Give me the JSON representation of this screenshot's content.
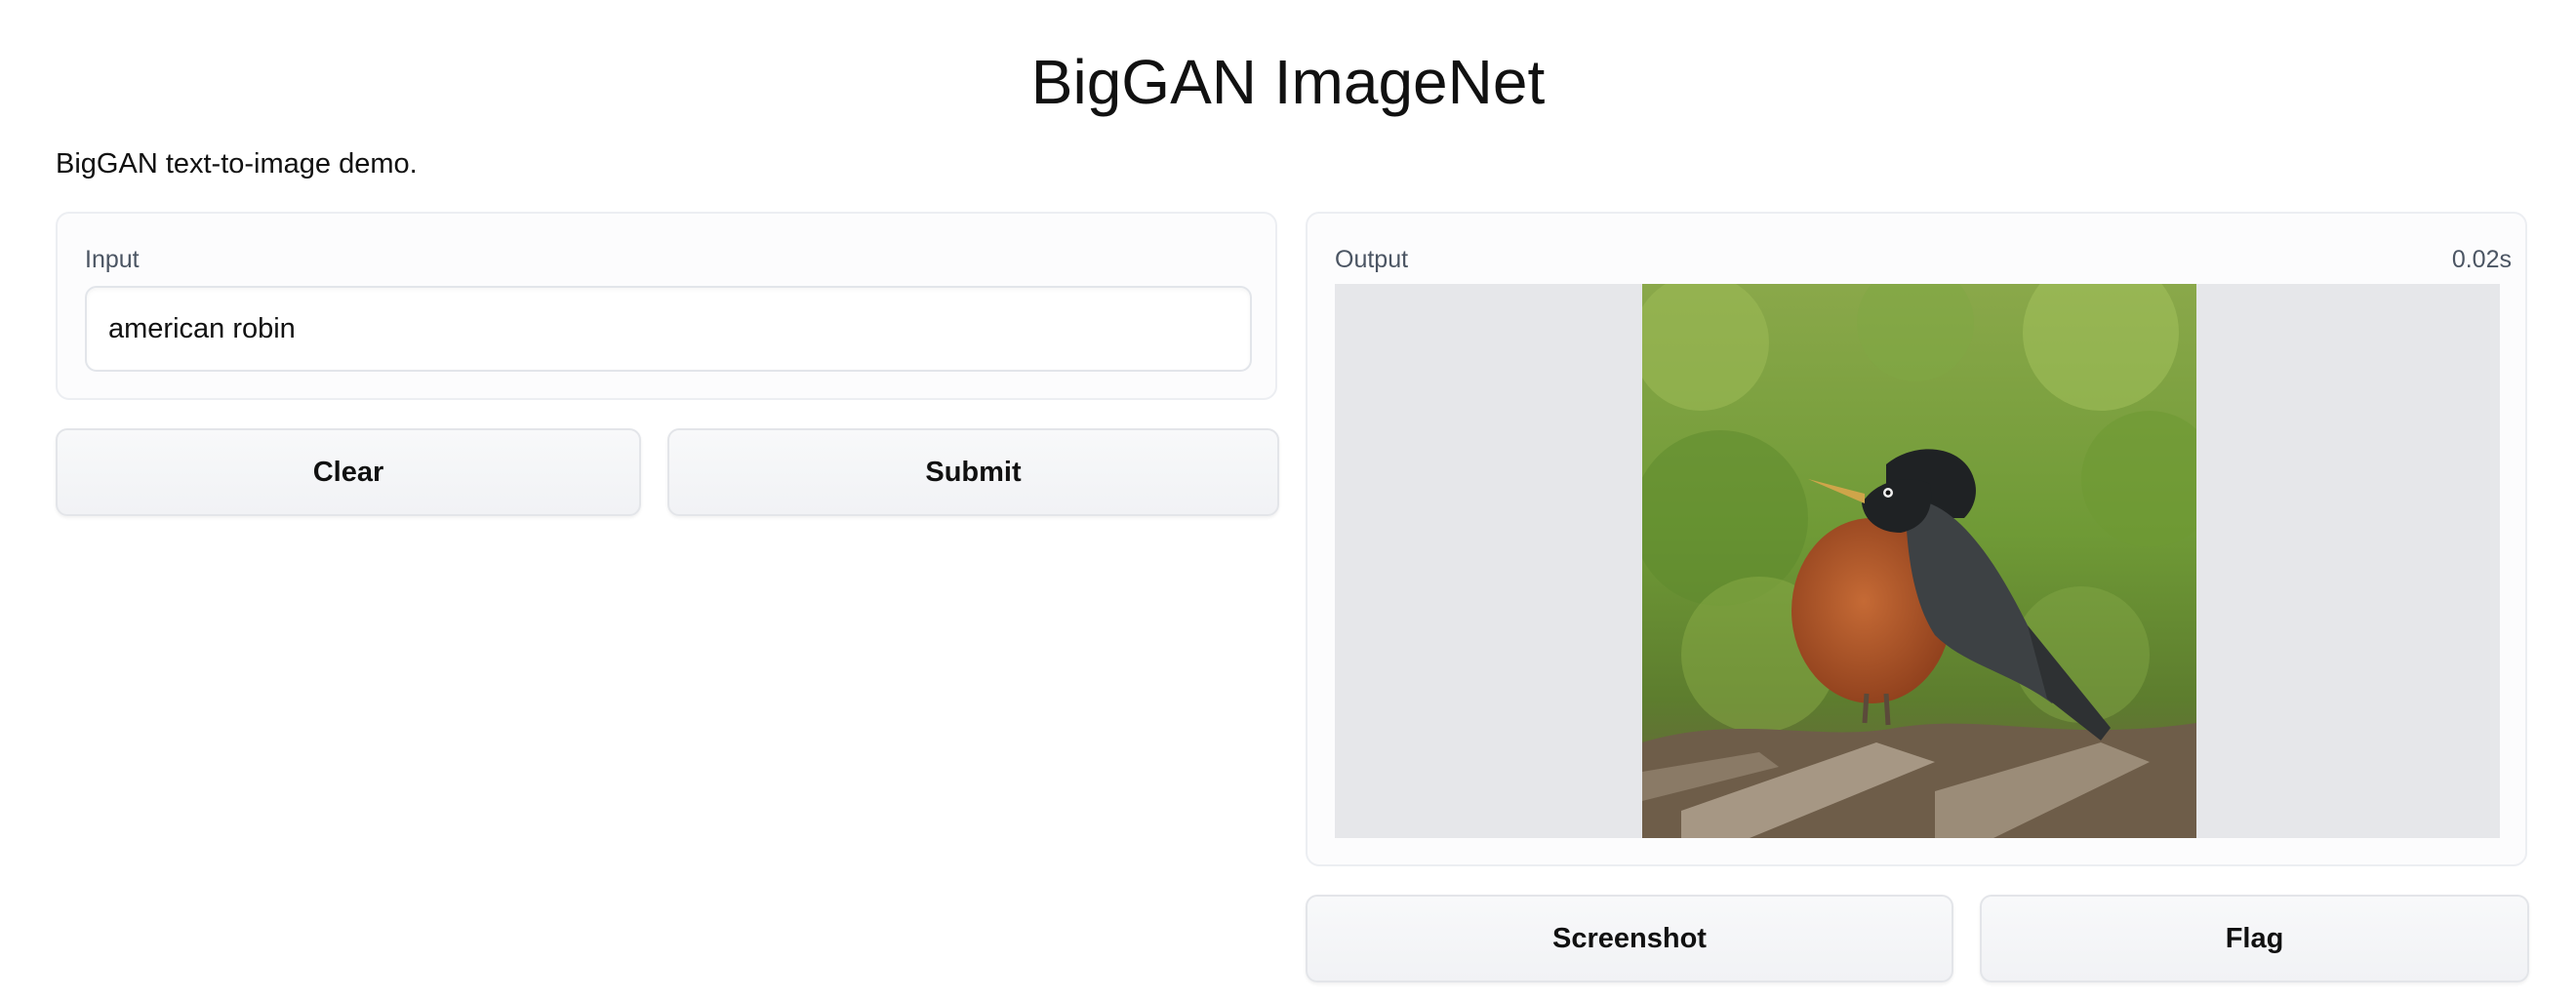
{
  "header": {
    "title": "BigGAN ImageNet",
    "description": "BigGAN text-to-image demo."
  },
  "input_panel": {
    "label": "Input",
    "value": "american robin"
  },
  "output_panel": {
    "label": "Output",
    "timer": "0.02s",
    "image_subject": "american robin bird standing on grass"
  },
  "buttons": {
    "clear": "Clear",
    "submit": "Submit",
    "screenshot": "Screenshot",
    "flag": "Flag"
  }
}
